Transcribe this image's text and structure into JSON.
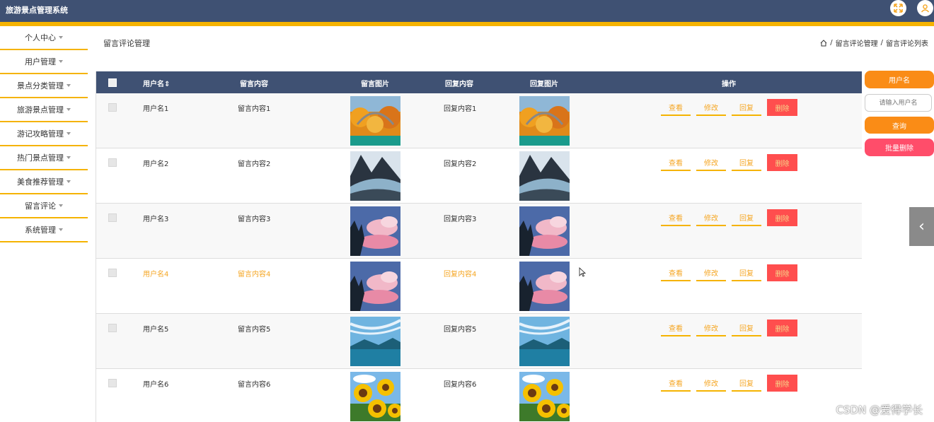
{
  "header": {
    "app_title": "旅游景点管理系统",
    "icons": [
      "fullscreen-icon",
      "user-icon"
    ],
    "bg_color": "#3f5173",
    "accent_color": "#f5b301"
  },
  "sidebar": {
    "items": [
      {
        "label": "个人中心"
      },
      {
        "label": "用户管理"
      },
      {
        "label": "景点分类管理"
      },
      {
        "label": "旅游景点管理"
      },
      {
        "label": "游记攻略管理"
      },
      {
        "label": "热门景点管理"
      },
      {
        "label": "美食推荐管理"
      },
      {
        "label": "留言评论"
      },
      {
        "label": "系统管理"
      }
    ]
  },
  "page": {
    "title": "留言评论管理",
    "breadcrumb": [
      "留言评论管理",
      "留言评论列表"
    ],
    "breadcrumb_sep": "/"
  },
  "table": {
    "columns": [
      "用户名",
      "留言内容",
      "留言图片",
      "回复内容",
      "回复图片",
      "操作"
    ],
    "sort_glyph": "⇕",
    "rows": [
      {
        "user": "用户名1",
        "content": "留言内容1",
        "reply": "回复内容1",
        "image": "autumn-bridge"
      },
      {
        "user": "用户名2",
        "content": "留言内容2",
        "reply": "回复内容2",
        "image": "mountain-river"
      },
      {
        "user": "用户名3",
        "content": "留言内容3",
        "reply": "回复内容3",
        "image": "pink-clouds"
      },
      {
        "user": "用户名4",
        "content": "留言内容4",
        "reply": "回复内容4",
        "image": "pink-clouds"
      },
      {
        "user": "用户名5",
        "content": "留言内容5",
        "reply": "回复内容5",
        "image": "blue-lake"
      },
      {
        "user": "用户名6",
        "content": "留言内容6",
        "reply": "回复内容6",
        "image": "sunflowers"
      }
    ],
    "actions": {
      "view": "查看",
      "edit": "修改",
      "reply": "回复",
      "delete": "删除"
    },
    "highlight_row": 4
  },
  "search_panel": {
    "label": "用户名",
    "placeholder": "请输入用户名",
    "search_button": "查询",
    "batch_delete_button": "批量删除"
  },
  "side_tab": {
    "icon": "chevron-left-icon",
    "glyph": "‹"
  },
  "watermark": "CSDN @爱得学长"
}
